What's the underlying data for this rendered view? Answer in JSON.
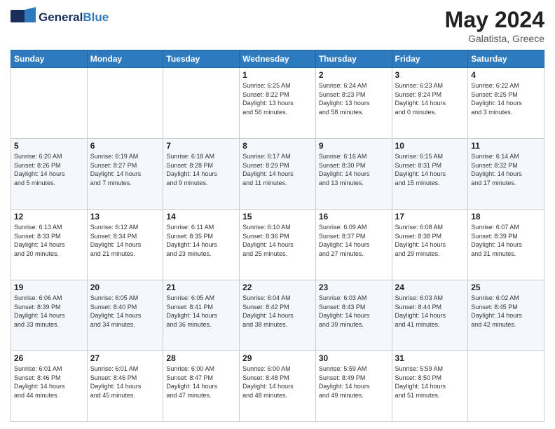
{
  "header": {
    "logo_general": "General",
    "logo_blue": "Blue",
    "month_title": "May 2024",
    "location": "Galatista, Greece"
  },
  "weekdays": [
    "Sunday",
    "Monday",
    "Tuesday",
    "Wednesday",
    "Thursday",
    "Friday",
    "Saturday"
  ],
  "weeks": [
    [
      {
        "day": "",
        "info": ""
      },
      {
        "day": "",
        "info": ""
      },
      {
        "day": "",
        "info": ""
      },
      {
        "day": "1",
        "info": "Sunrise: 6:25 AM\nSunset: 8:22 PM\nDaylight: 13 hours\nand 56 minutes."
      },
      {
        "day": "2",
        "info": "Sunrise: 6:24 AM\nSunset: 8:23 PM\nDaylight: 13 hours\nand 58 minutes."
      },
      {
        "day": "3",
        "info": "Sunrise: 6:23 AM\nSunset: 8:24 PM\nDaylight: 14 hours\nand 0 minutes."
      },
      {
        "day": "4",
        "info": "Sunrise: 6:22 AM\nSunset: 8:25 PM\nDaylight: 14 hours\nand 3 minutes."
      }
    ],
    [
      {
        "day": "5",
        "info": "Sunrise: 6:20 AM\nSunset: 8:26 PM\nDaylight: 14 hours\nand 5 minutes."
      },
      {
        "day": "6",
        "info": "Sunrise: 6:19 AM\nSunset: 8:27 PM\nDaylight: 14 hours\nand 7 minutes."
      },
      {
        "day": "7",
        "info": "Sunrise: 6:18 AM\nSunset: 8:28 PM\nDaylight: 14 hours\nand 9 minutes."
      },
      {
        "day": "8",
        "info": "Sunrise: 6:17 AM\nSunset: 8:29 PM\nDaylight: 14 hours\nand 11 minutes."
      },
      {
        "day": "9",
        "info": "Sunrise: 6:16 AM\nSunset: 8:30 PM\nDaylight: 14 hours\nand 13 minutes."
      },
      {
        "day": "10",
        "info": "Sunrise: 6:15 AM\nSunset: 8:31 PM\nDaylight: 14 hours\nand 15 minutes."
      },
      {
        "day": "11",
        "info": "Sunrise: 6:14 AM\nSunset: 8:32 PM\nDaylight: 14 hours\nand 17 minutes."
      }
    ],
    [
      {
        "day": "12",
        "info": "Sunrise: 6:13 AM\nSunset: 8:33 PM\nDaylight: 14 hours\nand 20 minutes."
      },
      {
        "day": "13",
        "info": "Sunrise: 6:12 AM\nSunset: 8:34 PM\nDaylight: 14 hours\nand 21 minutes."
      },
      {
        "day": "14",
        "info": "Sunrise: 6:11 AM\nSunset: 8:35 PM\nDaylight: 14 hours\nand 23 minutes."
      },
      {
        "day": "15",
        "info": "Sunrise: 6:10 AM\nSunset: 8:36 PM\nDaylight: 14 hours\nand 25 minutes."
      },
      {
        "day": "16",
        "info": "Sunrise: 6:09 AM\nSunset: 8:37 PM\nDaylight: 14 hours\nand 27 minutes."
      },
      {
        "day": "17",
        "info": "Sunrise: 6:08 AM\nSunset: 8:38 PM\nDaylight: 14 hours\nand 29 minutes."
      },
      {
        "day": "18",
        "info": "Sunrise: 6:07 AM\nSunset: 8:39 PM\nDaylight: 14 hours\nand 31 minutes."
      }
    ],
    [
      {
        "day": "19",
        "info": "Sunrise: 6:06 AM\nSunset: 8:39 PM\nDaylight: 14 hours\nand 33 minutes."
      },
      {
        "day": "20",
        "info": "Sunrise: 6:05 AM\nSunset: 8:40 PM\nDaylight: 14 hours\nand 34 minutes."
      },
      {
        "day": "21",
        "info": "Sunrise: 6:05 AM\nSunset: 8:41 PM\nDaylight: 14 hours\nand 36 minutes."
      },
      {
        "day": "22",
        "info": "Sunrise: 6:04 AM\nSunset: 8:42 PM\nDaylight: 14 hours\nand 38 minutes."
      },
      {
        "day": "23",
        "info": "Sunrise: 6:03 AM\nSunset: 8:43 PM\nDaylight: 14 hours\nand 39 minutes."
      },
      {
        "day": "24",
        "info": "Sunrise: 6:03 AM\nSunset: 8:44 PM\nDaylight: 14 hours\nand 41 minutes."
      },
      {
        "day": "25",
        "info": "Sunrise: 6:02 AM\nSunset: 8:45 PM\nDaylight: 14 hours\nand 42 minutes."
      }
    ],
    [
      {
        "day": "26",
        "info": "Sunrise: 6:01 AM\nSunset: 8:46 PM\nDaylight: 14 hours\nand 44 minutes."
      },
      {
        "day": "27",
        "info": "Sunrise: 6:01 AM\nSunset: 8:46 PM\nDaylight: 14 hours\nand 45 minutes."
      },
      {
        "day": "28",
        "info": "Sunrise: 6:00 AM\nSunset: 8:47 PM\nDaylight: 14 hours\nand 47 minutes."
      },
      {
        "day": "29",
        "info": "Sunrise: 6:00 AM\nSunset: 8:48 PM\nDaylight: 14 hours\nand 48 minutes."
      },
      {
        "day": "30",
        "info": "Sunrise: 5:59 AM\nSunset: 8:49 PM\nDaylight: 14 hours\nand 49 minutes."
      },
      {
        "day": "31",
        "info": "Sunrise: 5:59 AM\nSunset: 8:50 PM\nDaylight: 14 hours\nand 51 minutes."
      },
      {
        "day": "",
        "info": ""
      }
    ]
  ]
}
